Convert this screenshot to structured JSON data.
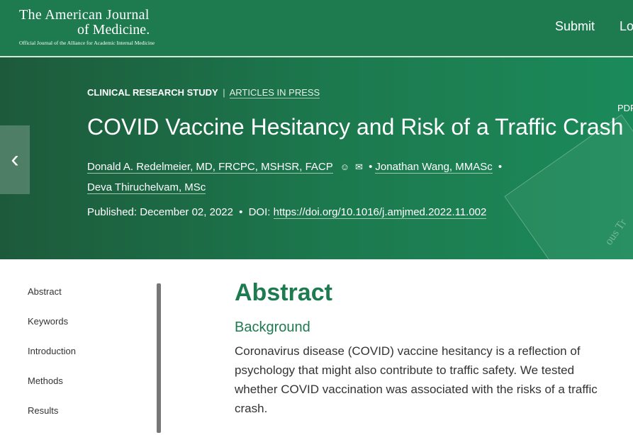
{
  "header": {
    "logo_line1": "The American Journal",
    "logo_line2": "of Medicine.",
    "logo_tagline": "Official Journal of the Alliance for Academic Internal Medicine",
    "nav_submit": "Submit",
    "nav_login": "Lo"
  },
  "article": {
    "kicker_type": "CLINICAL RESEARCH STUDY",
    "kicker_sep": "|",
    "kicker_status": "ARTICLES IN PRESS",
    "pdf_label": "PDF",
    "title": "COVID Vaccine Hesitancy and Risk of a Traffic Crash",
    "authors": [
      "Donald A. Redelmeier, MD, FRCPC, MSHSR, FACP",
      "Jonathan Wang, MMASc",
      "Deva Thiruchelvam, MSc"
    ],
    "bullet": "•",
    "published_label": "Published:",
    "published_date": "December 02, 2022",
    "doi_label": "DOI:",
    "doi_url": "https://doi.org/10.1016/j.amjmed.2022.11.002",
    "prev_arrow": "‹",
    "watermark_text": "ous Tr",
    "icons": [
      "user-icon",
      "mail-icon"
    ]
  },
  "toc": {
    "items": [
      "Abstract",
      "Keywords",
      "Introduction",
      "Methods",
      "Results"
    ]
  },
  "main": {
    "heading": "Abstract",
    "subheading": "Background",
    "paragraph": "Coronavirus disease (COVID) vaccine hesitancy is a reflection of psychology that might also contribute to traffic safety. We tested whether COVID vaccination was associated with the risks of a traffic crash."
  },
  "colors": {
    "brand_green": "#1e7a4f",
    "hero_dark": "#1d5a3b",
    "text": "#333333"
  }
}
